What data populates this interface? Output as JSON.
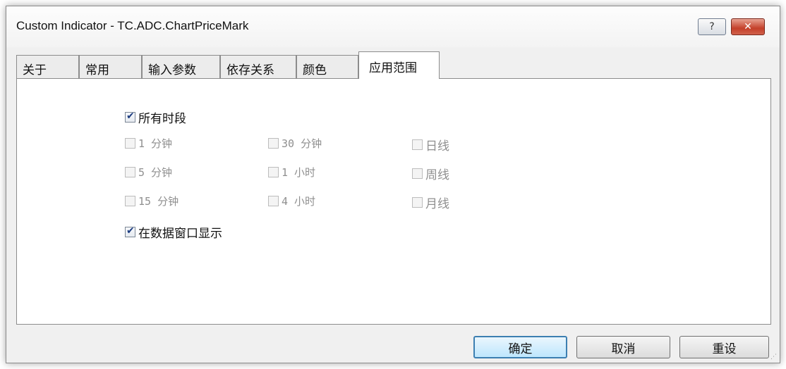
{
  "window": {
    "title": "Custom Indicator - TC.ADC.ChartPriceMark",
    "help_label": "?",
    "close_label": "✕"
  },
  "tabs": [
    {
      "label": "关于"
    },
    {
      "label": "常用"
    },
    {
      "label": "输入参数"
    },
    {
      "label": "依存关系"
    },
    {
      "label": "颜色"
    },
    {
      "label": "应用范围",
      "active": true
    }
  ],
  "options": {
    "all_periods": {
      "label": "所有时段",
      "checked": true
    },
    "periods": [
      {
        "label": "1 分钟",
        "checked": false,
        "enabled": false
      },
      {
        "label": "30 分钟",
        "checked": false,
        "enabled": false
      },
      {
        "label": "日线",
        "checked": false,
        "enabled": false
      },
      {
        "label": "5 分钟",
        "checked": false,
        "enabled": false
      },
      {
        "label": "1 小时",
        "checked": false,
        "enabled": false
      },
      {
        "label": "周线",
        "checked": false,
        "enabled": false
      },
      {
        "label": "15 分钟",
        "checked": false,
        "enabled": false
      },
      {
        "label": "4 小时",
        "checked": false,
        "enabled": false
      },
      {
        "label": "月线",
        "checked": false,
        "enabled": false
      }
    ],
    "show_in_data_window": {
      "label": "在数据窗口显示",
      "checked": true
    }
  },
  "buttons": {
    "ok": "确定",
    "cancel": "取消",
    "reset": "重设"
  },
  "colors": {
    "primary_border": "#3c7fb1",
    "close_red": "#c4402a"
  }
}
